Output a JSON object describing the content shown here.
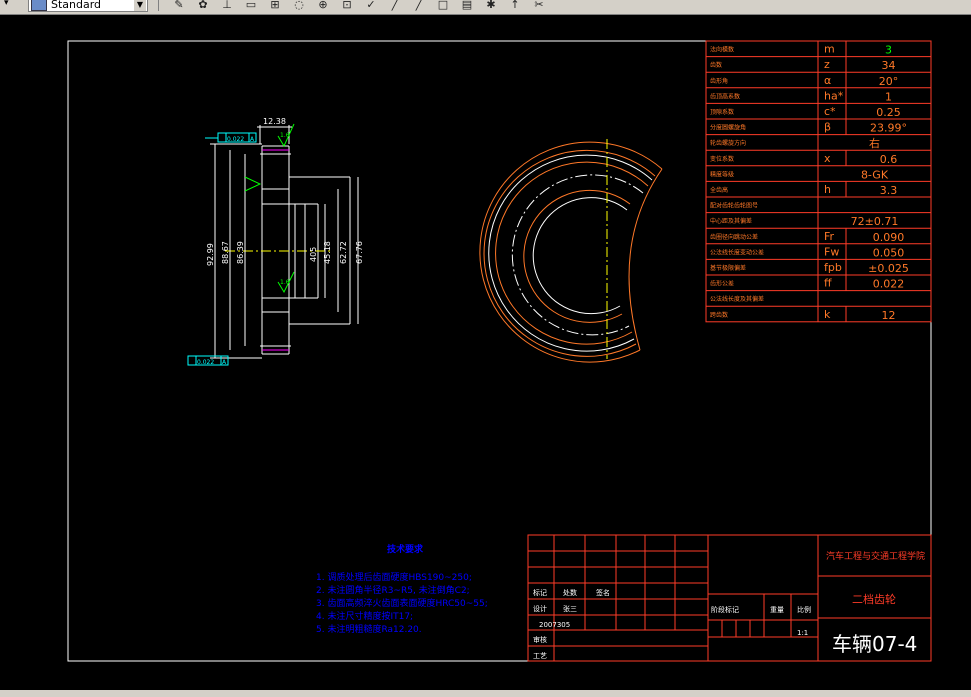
{
  "toolbar": {
    "style_combo_value": "Standard",
    "icons": [
      "pencil-icon",
      "paint-icon",
      "dimension-icon",
      "ruler-icon",
      "grid-icon",
      "zoom-realtime-icon",
      "zoom-window-icon",
      "block-icon",
      "match-properties-icon",
      "draw-line-icon",
      "pan-icon",
      "rectangle-icon",
      "layer-icon",
      "asterisk-icon",
      "arrow-icon",
      "eraser-icon"
    ]
  },
  "dimensions": {
    "top": "12.38",
    "tol_top": "0.022",
    "tol_datum_top": "A",
    "tol_bottom": "0.022",
    "tol_datum_bottom": "A",
    "rough_top": "1.6",
    "rough_mid": "1.6",
    "left_labels": [
      "92.99",
      "88.67",
      "86.39"
    ],
    "right_labels": [
      "405",
      "45.18",
      "62.72",
      "67.76"
    ]
  },
  "param_table": [
    {
      "name": "法向模数",
      "sym": "m",
      "val": "3"
    },
    {
      "name": "齿数",
      "sym": "z",
      "val": "34"
    },
    {
      "name": "齿形角",
      "sym": "α",
      "val": "20°"
    },
    {
      "name": "齿顶高系数",
      "sym": "ha*",
      "val": "1"
    },
    {
      "name": "顶隙系数",
      "sym": "c*",
      "val": "0.25"
    },
    {
      "name": "分度圆螺旋角",
      "sym": "β",
      "val": "23.99°"
    },
    {
      "name": "轮齿螺旋方向",
      "sym": "",
      "val": "右"
    },
    {
      "name": "变位系数",
      "sym": "x",
      "val": "0.6"
    },
    {
      "name": "精度等级",
      "sym": "",
      "val": "8-GK"
    },
    {
      "name": "全齿高",
      "sym": "h",
      "val": "3.3"
    },
    {
      "name": "配对齿轮齿轮图号",
      "sym": "",
      "val": ""
    },
    {
      "name": "中心距及其偏差",
      "sym": "",
      "val": "72±0.71"
    },
    {
      "name": "齿圈径向跳动公差",
      "sym": "Fr",
      "val": "0.090"
    },
    {
      "name": "公法线长度变动公差",
      "sym": "Fw",
      "val": "0.050"
    },
    {
      "name": "基节极限偏差",
      "sym": "fpb",
      "val": "±0.025"
    },
    {
      "name": "齿形公差",
      "sym": "ff",
      "val": "0.022"
    },
    {
      "name": "公法线长度及其偏差",
      "sym": "",
      "val": ""
    },
    {
      "name": "跨齿数",
      "sym": "k",
      "val": "12"
    }
  ],
  "tech_requirements": {
    "title": "技术要求",
    "items": [
      "1. 调质处理后齿面硬度HBS190~250;",
      "2. 未注圆角半径R3~R5, 未注倒角C2;",
      "3. 齿面高频淬火齿面表面硬度HRC50~55;",
      "4. 未注尺寸精度按IT17;",
      "5. 未注明粗糙度Ra12.20."
    ]
  },
  "title_block": {
    "school": "汽车工程与交通工程学院",
    "part_name": "二档齿轮",
    "drawing_no": "车辆07-4",
    "scale_label": "比例",
    "scale_value": "1:1",
    "weight_label": "重量",
    "stage_label": "阶段标记",
    "rows_left": [
      "标记",
      "设计",
      "审核",
      "工艺"
    ],
    "col_count": "处数",
    "col_sign": "签名",
    "designer": "张三",
    "date": "2007305"
  },
  "colors": {
    "background": "#000000",
    "frame": "#ffffff",
    "table_red": "#ff3c28",
    "text_orange": "#ff7828",
    "dim_white": "#ffffff",
    "blue_text": "#0000ff",
    "green": "#00ff00",
    "cyan": "#00ffff",
    "magenta": "#ff00ff",
    "yellow": "#ffff00"
  }
}
